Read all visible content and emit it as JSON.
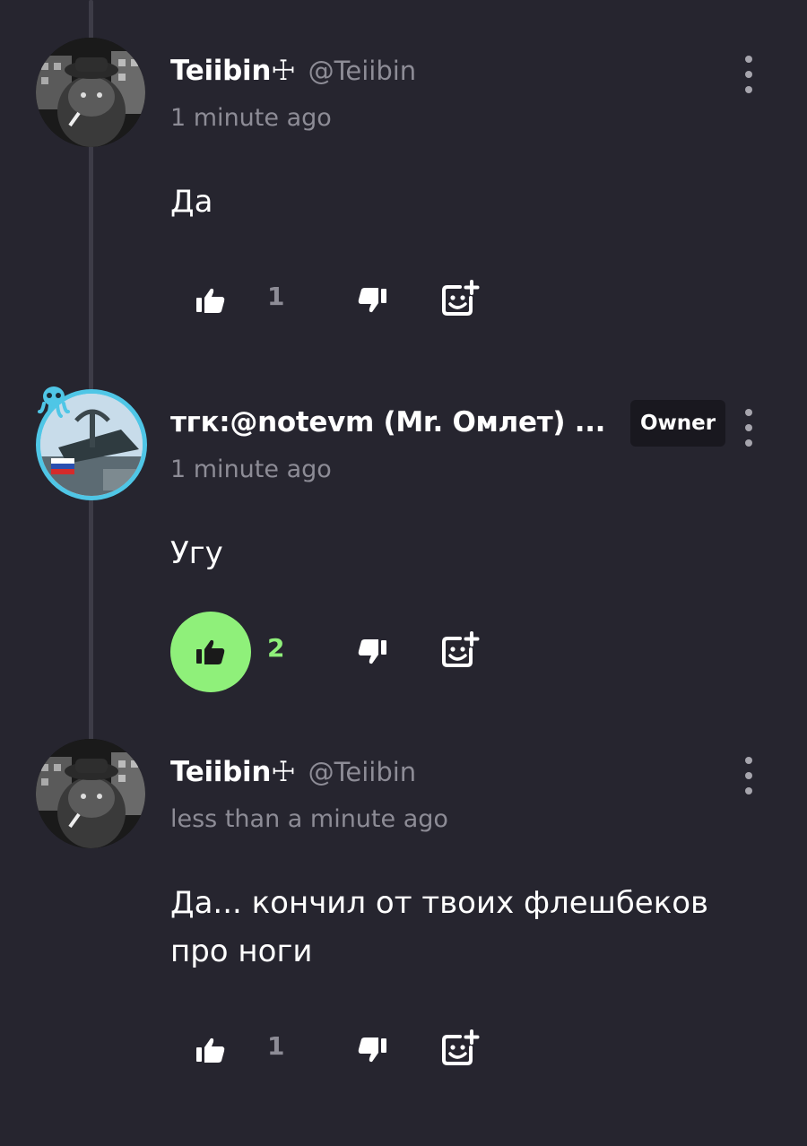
{
  "colors": {
    "background": "#26252f",
    "thread_line": "#3d3c47",
    "muted_text": "#8d8c96",
    "like_active": "#8ff07a",
    "owner_badge_bg": "#19181f",
    "avatar_ring": "#4fc6e6"
  },
  "comments": [
    {
      "author": "Teiibin☩",
      "handle": "@Teiibin",
      "timestamp": "1 minute ago",
      "body": "Да",
      "likes": "1",
      "liked": false,
      "avatar_icon": "cat-avatar-icon"
    },
    {
      "author": "тгк:@notevm (Mr. Омлет) ...",
      "badge": "Owner",
      "timestamp": "1 minute ago",
      "body": "Угу",
      "likes": "2",
      "liked": true,
      "avatar_icon": "monument-avatar-icon"
    },
    {
      "author": "Teiibin☩",
      "handle": "@Teiibin",
      "timestamp": "less than a minute ago",
      "body": "Да... кончил от твоих флешбеков про ноги",
      "likes": "1",
      "liked": false,
      "avatar_icon": "cat-avatar-icon"
    }
  ]
}
